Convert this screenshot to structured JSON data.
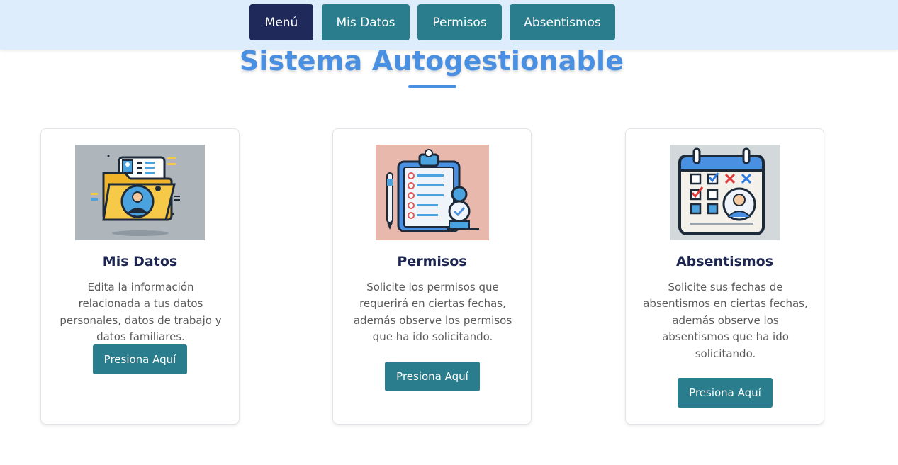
{
  "nav": {
    "items": [
      {
        "label": "Menú"
      },
      {
        "label": "Mis Datos"
      },
      {
        "label": "Permisos"
      },
      {
        "label": "Absentismos"
      }
    ]
  },
  "page": {
    "title": "Sistema Autogestionable"
  },
  "cards": [
    {
      "title": "Mis Datos",
      "description": "Edita la información relacionada a tus datos personales, datos de trabajo y datos familiares.",
      "button_label": "Presiona Aquí",
      "icon": "folder-profile-icon"
    },
    {
      "title": "Permisos",
      "description": "Solicite los permisos que requerirá en ciertas fechas, además observe los permisos que ha ido solicitando.",
      "button_label": "Presiona Aquí",
      "icon": "clipboard-checklist-icon"
    },
    {
      "title": "Absentismos",
      "description": "Solicite sus fechas de absentismos en ciertas fechas, además observe los absentismos que ha ido solicitando.",
      "button_label": "Presiona Aquí",
      "icon": "calendar-absence-icon"
    }
  ],
  "colors": {
    "topbar": "#deedfb",
    "nav_active": "#1f2a5a",
    "nav_teal": "#2a7d8c",
    "title": "#4a90e2",
    "card_title": "#1d2650"
  }
}
